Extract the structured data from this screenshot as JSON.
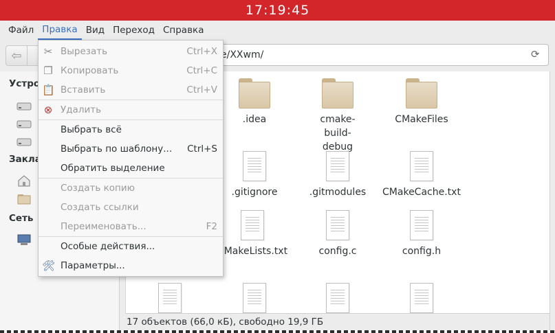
{
  "titlebar": {
    "clock": "17:19:45"
  },
  "menubar": {
    "items": [
      {
        "label": "Файл"
      },
      {
        "label": "Правка"
      },
      {
        "label": "Вид"
      },
      {
        "label": "Переход"
      },
      {
        "label": "Справка"
      }
    ]
  },
  "toolbar": {
    "location_text": "e/XXwm/"
  },
  "sidebar": {
    "headings": [
      "Устрой",
      "Заклад",
      "Сеть"
    ],
    "devices": [
      "C",
      "",
      "S"
    ],
    "bookmarks": [
      "",
      ""
    ],
    "network": [
      ""
    ]
  },
  "edit_menu": {
    "items": [
      {
        "label": "Вырезать",
        "shortcut": "Ctrl+X",
        "icon": "scissors-icon"
      },
      {
        "label": "Копировать",
        "shortcut": "Ctrl+C",
        "icon": "copy-icon"
      },
      {
        "label": "Вставить",
        "shortcut": "Ctrl+V",
        "icon": "paste-icon"
      },
      {
        "label": "Удалить",
        "shortcut": "",
        "icon": "delete-icon"
      },
      {
        "label": "Выбрать всё",
        "shortcut": "",
        "icon": ""
      },
      {
        "label": "Выбрать по шаблону...",
        "shortcut": "Ctrl+S",
        "icon": ""
      },
      {
        "label": "Обратить выделение",
        "shortcut": "",
        "icon": ""
      },
      {
        "label": "Создать копию",
        "shortcut": "",
        "icon": ""
      },
      {
        "label": "Создать ссылки",
        "shortcut": "",
        "icon": ""
      },
      {
        "label": "Переименовать...",
        "shortcut": "F2",
        "icon": ""
      },
      {
        "label": "Особые действия...",
        "shortcut": "",
        "icon": ""
      },
      {
        "label": "Параметры...",
        "shortcut": "",
        "icon": "tools-icon"
      }
    ]
  },
  "files": [
    {
      "name": ".idea",
      "kind": "folder"
    },
    {
      "name": "cmake-build-debug",
      "kind": "folder"
    },
    {
      "name": "CMakeFiles",
      "kind": "folder"
    },
    {
      "name": ".gitignore",
      "kind": "file"
    },
    {
      "name": ".gitmodules",
      "kind": "file"
    },
    {
      "name": "CMakeCache.txt",
      "kind": "file"
    },
    {
      "name": "CMakeLists.txt",
      "kind": "file"
    },
    {
      "name": "config.c",
      "kind": "file"
    },
    {
      "name": "config.h",
      "kind": "file"
    }
  ],
  "statusbar": {
    "text": "17 объектов (66,0 кБ), свободно 19,9 ГБ"
  }
}
